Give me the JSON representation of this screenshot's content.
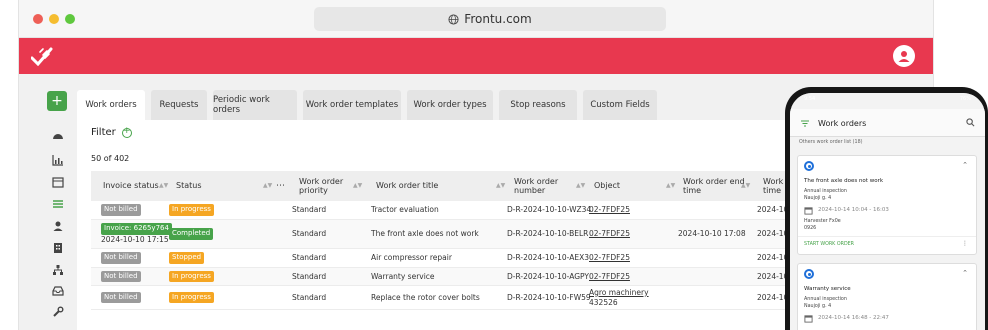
{
  "browser": {
    "url": "Frontu.com"
  },
  "colors": {
    "brand": "#e8384f",
    "green": "#47a34a",
    "orange": "#f5a623",
    "grey_badge": "#9b9b9b",
    "red_badge": "#e8384f",
    "link_blue": "#1e6fd9"
  },
  "sidebar": {
    "add_label": "+",
    "icons": [
      "dashboard-icon",
      "chart-icon",
      "calendar-icon",
      "list-icon",
      "user-icon",
      "building-icon",
      "hierarchy-icon",
      "inbox-icon",
      "wrench-icon"
    ]
  },
  "tabs": [
    "Work orders",
    "Requests",
    "Periodic work orders",
    "Work order templates",
    "Work order types",
    "Stop reasons",
    "Custom Fields"
  ],
  "filter": {
    "label": "Filter"
  },
  "count_text": "50 of 402",
  "table": {
    "headers": {
      "invoice": "Invoice status",
      "status": "Status",
      "priority": "Work order priority",
      "title": "Work order title",
      "number": "Work order number",
      "object": "Object",
      "end": "Work order end time",
      "time": "Work order time"
    },
    "rows": [
      {
        "invoice": "Not billed",
        "invoice_date": "",
        "status": "In progress",
        "priority": "Standard",
        "title": "Tractor evaluation",
        "number": "D-R-2024-10-10-WZ34",
        "object": "02-7FDF25",
        "object_sub": "",
        "end": "",
        "time": "2024-10-1"
      },
      {
        "invoice": "Invoice: 6265y764",
        "invoice_date": "2024-10-10 17:15",
        "status": "Completed",
        "priority": "Standard",
        "title": "The front axle does not work",
        "number": "D-R-2024-10-10-BELR",
        "object": "02-7FDF25",
        "object_sub": "",
        "end": "2024-10-10 17:08",
        "time": "2024-10-1"
      },
      {
        "invoice": "Not billed",
        "invoice_date": "",
        "status": "Stopped",
        "priority": "Standard",
        "title": "Air compressor repair",
        "number": "D-R-2024-10-10-AEX3",
        "object": "02-7FDF25",
        "object_sub": "",
        "end": "",
        "time": "2024-10-1"
      },
      {
        "invoice": "Not billed",
        "invoice_date": "",
        "status": "In progress",
        "priority": "Standard",
        "title": "Warranty service",
        "number": "D-R-2024-10-10-AGPY",
        "object": "02-7FDF25",
        "object_sub": "",
        "end": "",
        "time": "2024-10-1"
      },
      {
        "invoice": "Not billed",
        "invoice_date": "",
        "status": "In progress",
        "priority": "Standard",
        "title": "Replace the rotor cover bolts",
        "number": "D-R-2024-10-10-FW59",
        "object": "Agro machinery",
        "object_sub": "432526",
        "end": "",
        "time": "2024-10-1"
      }
    ]
  },
  "phone": {
    "status_time": "9:54",
    "status_right": "76%",
    "title": "Work orders",
    "subtitle": "Others work order list (18)",
    "cards": [
      {
        "title": "The front axle does not work",
        "type": "Annual inspection",
        "address": "Naujoji g. 4",
        "date": "2024-10-14 10:04 - 16:03",
        "asset": "Harvester Fx0e",
        "asset_code": "0926",
        "action": "START WORK ORDER"
      },
      {
        "title": "Warranty service",
        "type": "Annual inspection",
        "address": "Naujoji g. 4",
        "date": "2024-10-14 16:48 - 22:47"
      }
    ]
  }
}
